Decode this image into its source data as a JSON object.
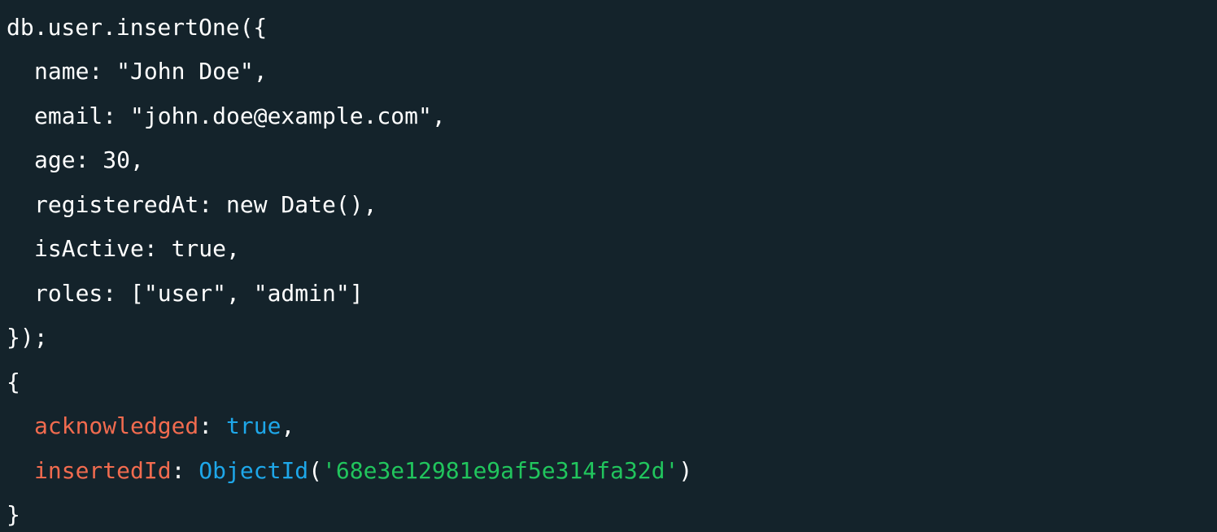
{
  "shell": {
    "command_lines": [
      "db.user.insertOne({",
      "name: \"John Doe\",",
      "email: \"john.doe@example.com\",",
      "age: 30,",
      "registeredAt: new Date(),",
      "isActive: true,",
      "roles: [\"user\", \"admin\"]",
      "});"
    ],
    "result": {
      "open_brace": "{",
      "acknowledged_key": "acknowledged",
      "acknowledged_value": "true",
      "inserted_id_key": "insertedId",
      "object_id_fn": "ObjectId",
      "object_id_value": "'68e3e12981e9af5e314fa32d'",
      "close_brace": "}"
    }
  },
  "colors": {
    "background": "#14232b",
    "text": "#ffffff",
    "key": "#f16b4f",
    "keyword": "#1ea7e9",
    "string": "#21c55d"
  }
}
